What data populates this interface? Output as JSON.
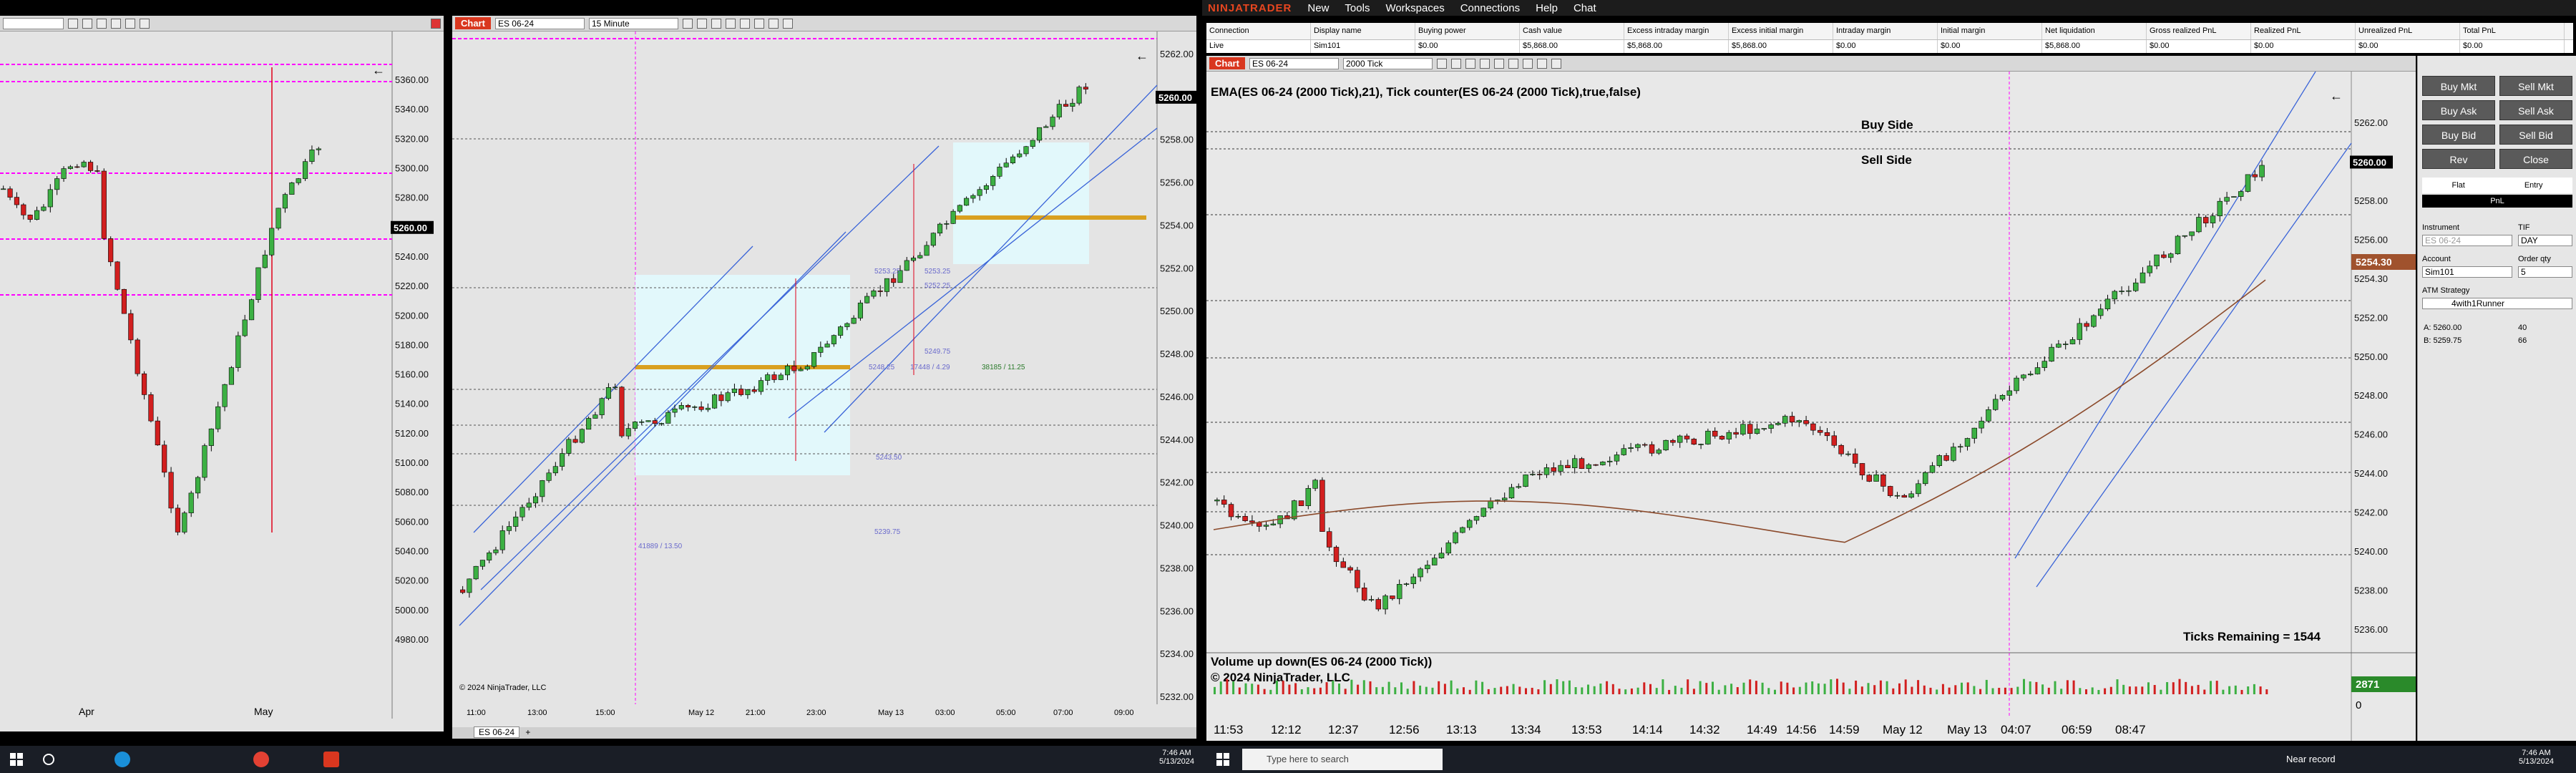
{
  "app": {
    "brand": "NINJATRADER",
    "menu": [
      "New",
      "Tools",
      "Workspaces",
      "Connections",
      "Help",
      "Chat"
    ]
  },
  "left_chart": {
    "price_labels": [
      "5360.00",
      "5340.00",
      "5320.00",
      "5300.00",
      "5280.00",
      "5260.00",
      "5240.00",
      "5220.00",
      "5200.00",
      "5180.00",
      "5160.00",
      "5140.00",
      "5120.00",
      "5100.00",
      "5080.00",
      "5060.00",
      "5040.00",
      "5020.00",
      "5000.00",
      "4980.00"
    ],
    "current_price": "5260.00",
    "time_labels": [
      "Apr",
      "May"
    ]
  },
  "mid_chart": {
    "tab": "Chart",
    "instrument": "ES 06-24",
    "interval": "15 Minute",
    "price_labels": [
      "5262.00",
      "5260.00",
      "5258.00",
      "5256.00",
      "5254.00",
      "5252.00",
      "5250.00",
      "5248.00",
      "5246.00",
      "5244.00",
      "5242.00",
      "5240.00",
      "5238.00",
      "5236.00",
      "5234.00",
      "5232.00"
    ],
    "current_price": "5260.00",
    "time_labels": [
      "11:00",
      "13:00",
      "15:00",
      "May 12",
      "21:00",
      "23:00",
      "May 13",
      "03:00",
      "05:00",
      "07:00",
      "09:00"
    ],
    "copyright": "© 2024 NinjaTrader, LLC",
    "bottom_tab": "ES 06-24",
    "annotations": [
      "5253.25",
      "5253.25",
      "5252.25",
      "5249.75",
      "5248.25",
      "17448 / 4.29",
      "38185 / 11.25",
      "5243.50",
      "41889 / 13.50",
      "5239.75"
    ]
  },
  "right_chart": {
    "tab": "Chart",
    "instrument": "ES 06-24",
    "interval": "2000 Tick",
    "indicator_label": "EMA(ES 06-24 (2000 Tick),21), Tick counter(ES 06-24 (2000 Tick),true,false)",
    "buy_side": "Buy Side",
    "sell_side": "Sell Side",
    "ticks_remaining": "Ticks Remaining = 1544",
    "volume_label": "Volume up down(ES 06-24 (2000 Tick))",
    "copyright": "© 2024 NinjaTrader, LLC",
    "price_labels": [
      "5262.00",
      "5260.00",
      "5258.00",
      "5256.00",
      "5254.30",
      "5252.00",
      "5250.00",
      "5248.00",
      "5246.00",
      "5244.00",
      "5242.00",
      "5240.00",
      "5238.00",
      "5236.00"
    ],
    "current_price": "5260.00",
    "ema_price": "5254.30",
    "volume_value": "2871",
    "volume_zero": "0",
    "time_labels": [
      "11:53",
      "12:12",
      "12:37",
      "12:56",
      "13:13",
      "13:34",
      "13:53",
      "14:14",
      "14:32",
      "14:49",
      "14:56",
      "14:59",
      "May 12",
      "May 13",
      "04:07",
      "06:59",
      "08:47"
    ]
  },
  "accounts": {
    "headers": [
      "Connection",
      "Display name",
      "Buying power",
      "Cash value",
      "Excess intraday margin",
      "Excess initial margin",
      "Intraday margin",
      "Initial margin",
      "Net liquidation",
      "Gross realized PnL",
      "Realized PnL",
      "Unrealized PnL",
      "Total PnL"
    ],
    "row": [
      "Live",
      "Sim101",
      "$0.00",
      "$5,868.00",
      "$5,868.00",
      "$5,868.00",
      "$0.00",
      "$0.00",
      "$5,868.00",
      "$0.00",
      "$0.00",
      "$0.00",
      "$0.00"
    ]
  },
  "chart_trader": {
    "buttons": [
      [
        "Buy Mkt",
        "Sell Mkt"
      ],
      [
        "Buy Ask",
        "Sell Ask"
      ],
      [
        "Buy Bid",
        "Sell Bid"
      ],
      [
        "Rev",
        "Close"
      ]
    ],
    "flat": "Flat",
    "entry": "Entry",
    "pnl": "PnL",
    "instrument_label": "Instrument",
    "instrument_value": "ES 06-24",
    "tif_label": "TIF",
    "tif_value": "DAY",
    "account_label": "Account",
    "account_value": "Sim101",
    "order_qty_label": "Order qty",
    "order_qty_value": "5",
    "atm_label": "ATM Strategy",
    "atm_value": "4with1Runner",
    "ask_label": "A: 5260.00",
    "ask_size": "40",
    "bid_label": "B: 5259.75",
    "bid_size": "66"
  },
  "taskbar": {
    "search_placeholder": "Type here to search",
    "clock_left_time": "7:46 AM",
    "clock_left_date": "5/13/2024",
    "clock_right_time": "7:46 AM",
    "clock_right_date": "5/13/2024",
    "near_record": "Near record"
  }
}
